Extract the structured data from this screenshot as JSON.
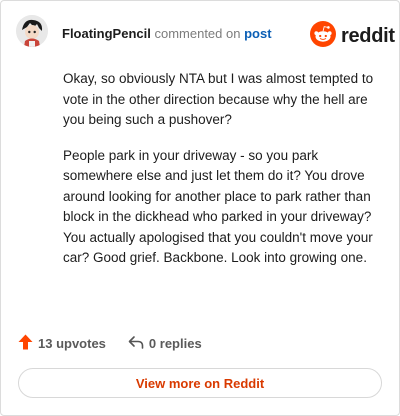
{
  "header": {
    "username": "FloatingPencil",
    "action_text": "commented on",
    "post_link_text": "post",
    "brand_word": "reddit"
  },
  "comment": {
    "paragraphs": [
      "Okay, so obviously NTA but I was almost tempted to vote in the other direction because why the hell are you being such a pushover?",
      "People park in your driveway - so you park somewhere else and just let them do it? You drove around looking for another place to park rather than block in the dickhead who parked in your driveway? You actually apologised that you couldn't move your car? Good grief. Backbone. Look into growing one."
    ]
  },
  "footer": {
    "upvotes_label": "13 upvotes",
    "replies_label": "0 replies",
    "view_more_label": "View more on Reddit"
  },
  "icons": {
    "upvote": "upvote-arrow-icon",
    "reply": "reply-arrow-icon",
    "brand": "reddit-snoo-icon"
  },
  "colors": {
    "accent": "#ff4500",
    "link": "#0b5fb5",
    "view_more_text": "#d93a00"
  }
}
